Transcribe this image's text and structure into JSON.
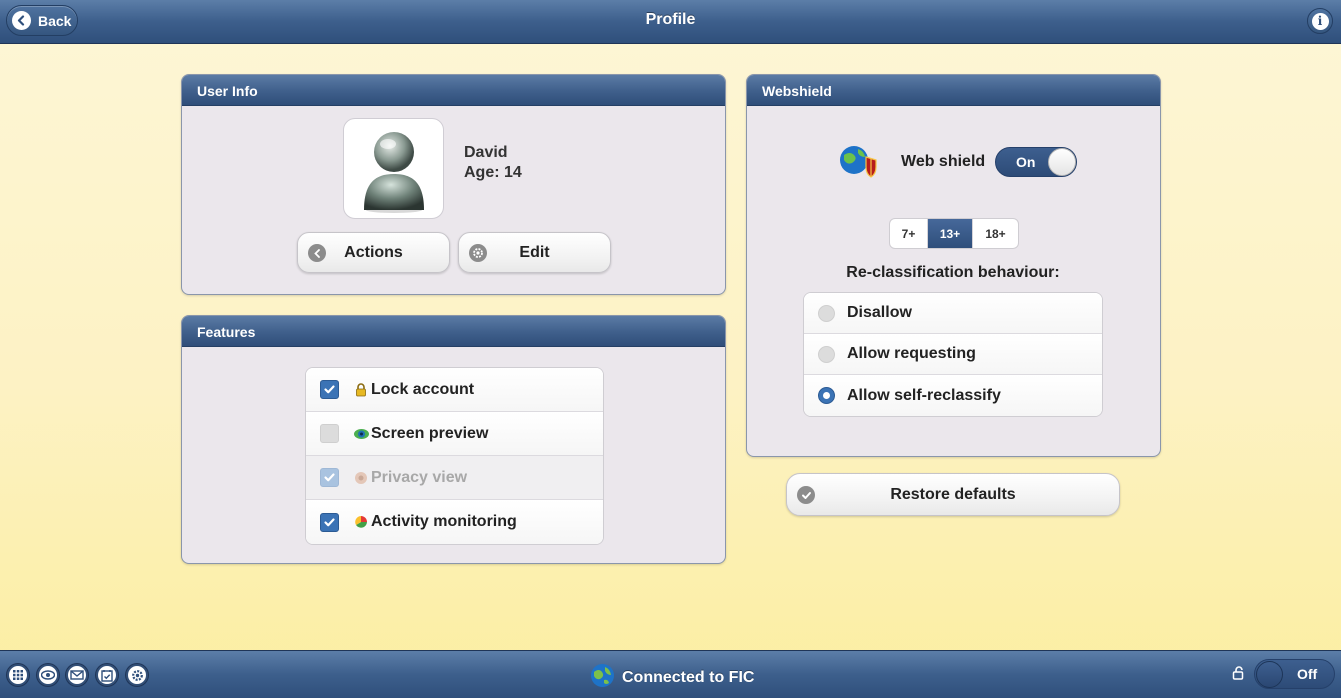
{
  "header": {
    "back_label": "Back",
    "title": "Profile",
    "info_icon": "info-icon"
  },
  "user_info": {
    "heading": "User Info",
    "name": "David",
    "age": "Age: 14",
    "actions_label": "Actions",
    "edit_label": "Edit"
  },
  "features": {
    "heading": "Features",
    "items": [
      {
        "label": "Lock account",
        "checked": true,
        "enabled": true,
        "icon": "lock-icon"
      },
      {
        "label": "Screen preview",
        "checked": false,
        "enabled": true,
        "icon": "eye-icon"
      },
      {
        "label": "Privacy view",
        "checked": true,
        "enabled": false,
        "icon": "privacy-icon"
      },
      {
        "label": "Activity monitoring",
        "checked": true,
        "enabled": true,
        "icon": "activity-chart-icon"
      }
    ]
  },
  "webshield": {
    "heading": "Webshield",
    "label": "Web shield",
    "toggle_state": "On",
    "age_levels": [
      "7+",
      "13+",
      "18+"
    ],
    "selected_age_level": "13+",
    "reclass_title": "Re-classification behaviour:",
    "options": [
      {
        "label": "Disallow",
        "selected": false
      },
      {
        "label": "Allow requesting",
        "selected": false
      },
      {
        "label": "Allow self-reclassify",
        "selected": true
      }
    ]
  },
  "restore_label": "Restore defaults",
  "footer": {
    "status": "Connected to FIC",
    "toggle_state": "Off",
    "icons": [
      "apps-grid-icon",
      "eye-icon",
      "mail-icon",
      "calendar-icon",
      "settings-icon"
    ]
  },
  "colors": {
    "bar": "#3d5f8c",
    "accent": "#3b73b5",
    "panel_bg": "#ebe7ec",
    "page_bg": "#fdf2c4"
  }
}
